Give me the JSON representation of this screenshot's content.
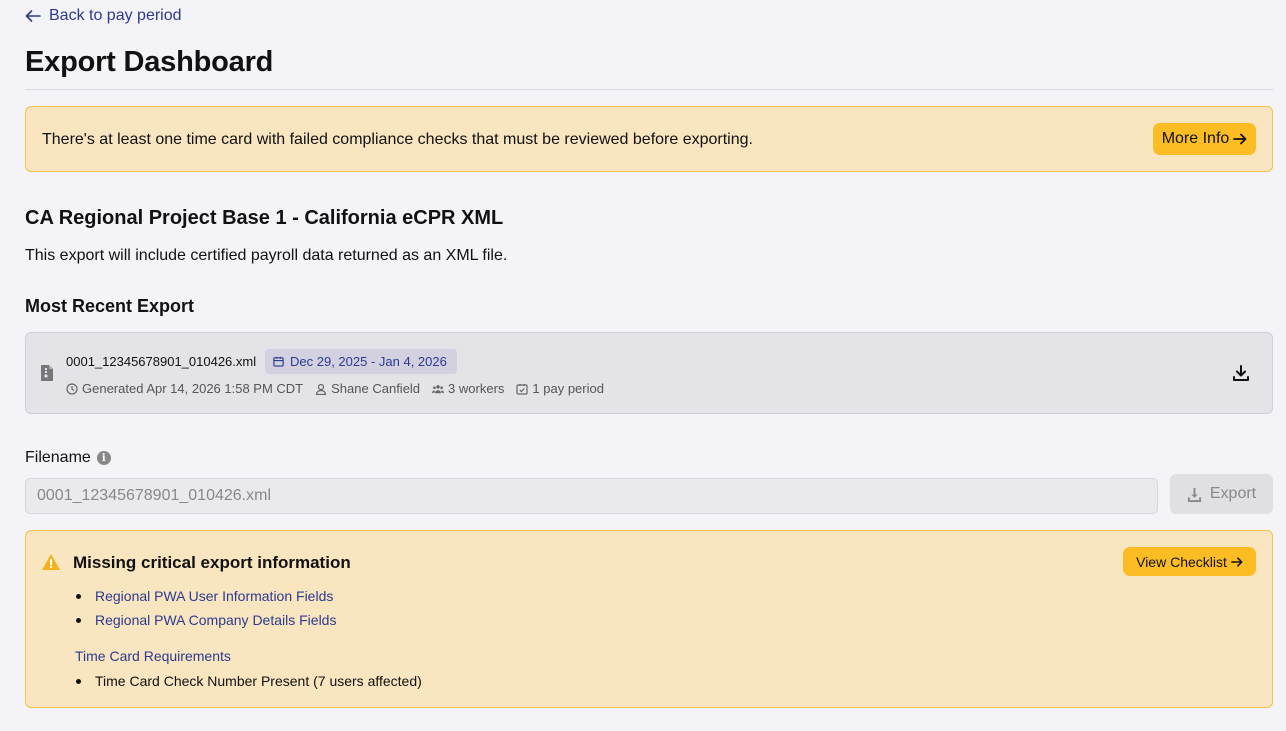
{
  "nav": {
    "back_label": "Back to pay period"
  },
  "page": {
    "title": "Export Dashboard"
  },
  "alert": {
    "message": "There's at least one time card with failed compliance checks that must be reviewed before exporting.",
    "button_label": "More Info"
  },
  "export_config": {
    "title": "CA Regional Project Base 1 - California eCPR XML",
    "description": "This export will include certified payroll data returned as an XML file."
  },
  "recent_export": {
    "heading": "Most Recent Export",
    "file_name": "0001_12345678901_010426.xml",
    "date_range": "Dec 29, 2025 - Jan 4, 2026",
    "generated": "Generated Apr 14, 2026 1:58 PM CDT",
    "user": "Shane Canfield",
    "workers": "3 workers",
    "pay_periods": "1 pay period"
  },
  "filename_field": {
    "label": "Filename",
    "placeholder": "0001_12345678901_010426.xml"
  },
  "export_button": {
    "label": "Export"
  },
  "missing_info": {
    "title": "Missing critical export information",
    "button_label": "View Checklist",
    "links": [
      "Regional PWA User Information Fields",
      "Regional PWA Company Details Fields"
    ],
    "time_card_heading": "Time Card Requirements",
    "time_card_items": [
      "Time Card Check Number Present (7 users affected)"
    ]
  },
  "colors": {
    "background": "#f4f3f7",
    "link": "#2b3a8f",
    "warning_bg": "#f9e6c0",
    "warning_border": "#f4c24a",
    "accent_button": "#fbbd23"
  },
  "icons": {
    "back": "arrow-left-icon",
    "more_info": "arrow-right-icon",
    "file": "file-icon",
    "calendar": "calendar-icon",
    "clock": "clock-icon",
    "user": "user-icon",
    "workers": "users-icon",
    "pay_period": "calendar-check-icon",
    "download": "download-icon",
    "info": "info-icon",
    "warning": "warning-triangle-icon"
  }
}
